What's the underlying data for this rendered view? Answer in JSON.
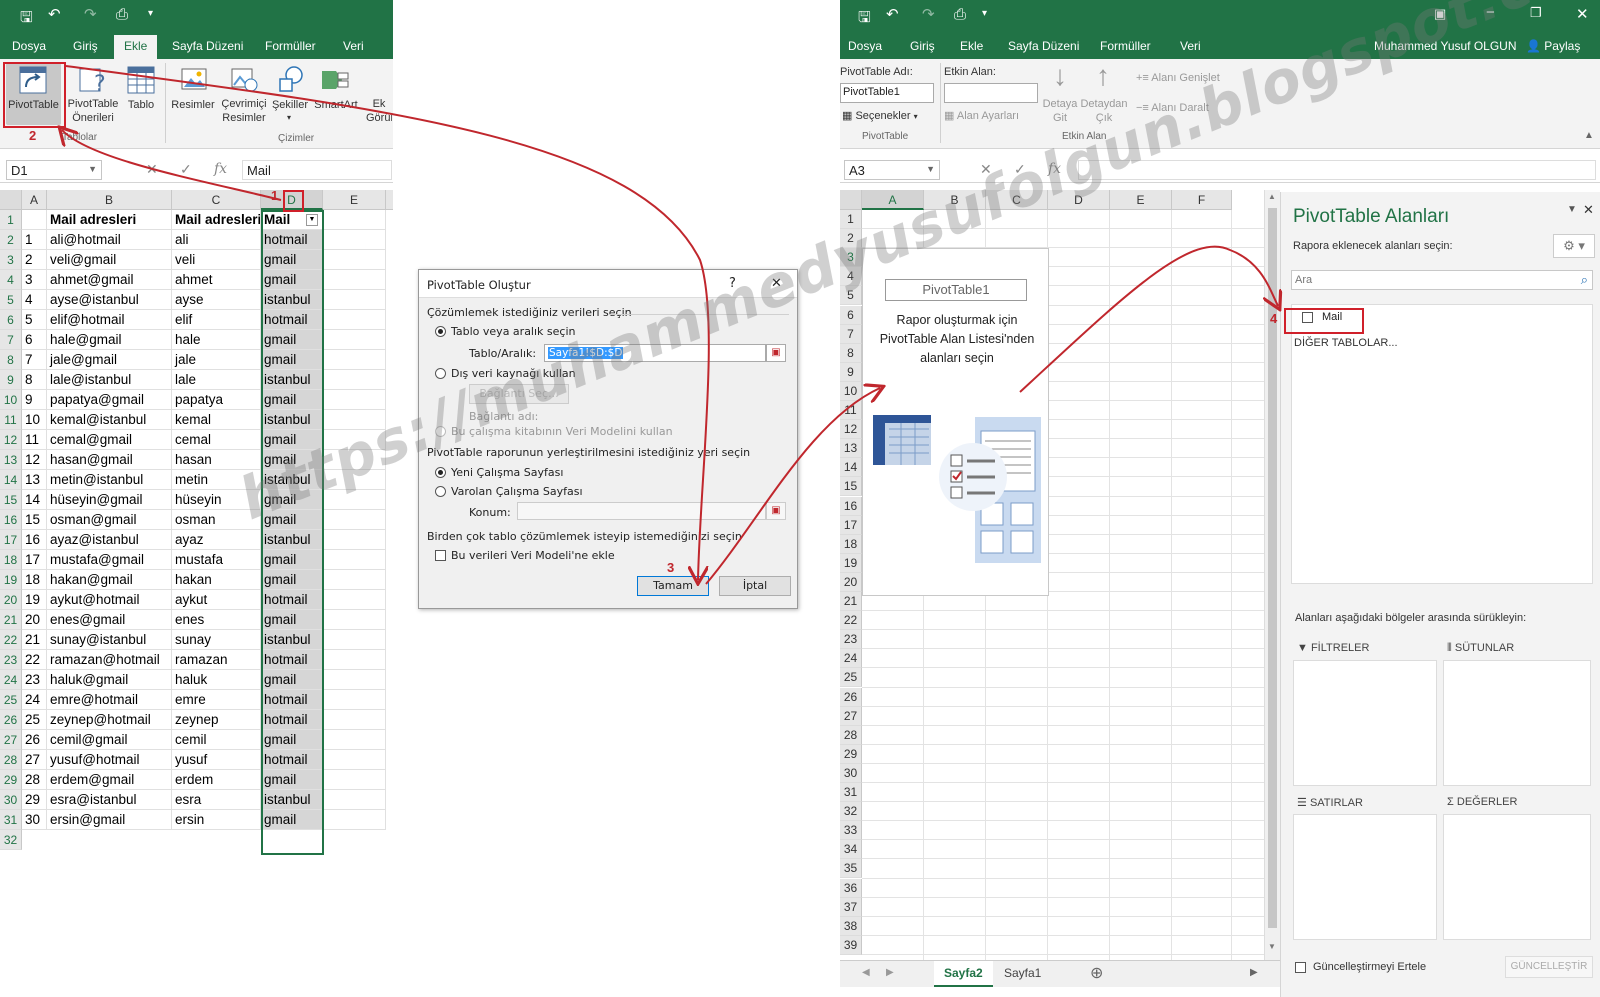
{
  "left": {
    "tabs": [
      "Dosya",
      "Giriş",
      "Ekle",
      "Sayfa Düzeni",
      "Formüller",
      "Veri"
    ],
    "active_tab": "Ekle",
    "ribbon": {
      "pivottable": "PivotTable",
      "pivot_onerileri": "PivotTable Önerileri",
      "tablo": "Tablo",
      "resimler": "Resimler",
      "cevrimici_resimler": "Çevrimiçi Resimler",
      "sekiller": "Şekiller",
      "smartart": "SmartArt",
      "ek_gorunum": "Ek Görün",
      "group_tablolar": "Tablolar",
      "group_cizimler": "Çizimler"
    },
    "namebox": "D1",
    "formula": "Mail",
    "columns": [
      "A",
      "B",
      "C",
      "D",
      "E"
    ],
    "header_row": {
      "b": "Mail adresleri",
      "c": "Mail adresleri",
      "d": "Mail"
    },
    "rows": [
      {
        "a": "1",
        "b": "ali@hotmail",
        "c": "ali",
        "d": "hotmail"
      },
      {
        "a": "2",
        "b": "veli@gmail",
        "c": "veli",
        "d": "gmail"
      },
      {
        "a": "3",
        "b": "ahmet@gmail",
        "c": "ahmet",
        "d": "gmail"
      },
      {
        "a": "4",
        "b": "ayse@istanbul",
        "c": "ayse",
        "d": "istanbul"
      },
      {
        "a": "5",
        "b": "elif@hotmail",
        "c": "elif",
        "d": "hotmail"
      },
      {
        "a": "6",
        "b": "hale@gmail",
        "c": "hale",
        "d": "gmail"
      },
      {
        "a": "7",
        "b": "jale@gmail",
        "c": "jale",
        "d": "gmail"
      },
      {
        "a": "8",
        "b": "lale@istanbul",
        "c": "lale",
        "d": "istanbul"
      },
      {
        "a": "9",
        "b": "papatya@gmail",
        "c": "papatya",
        "d": "gmail"
      },
      {
        "a": "10",
        "b": "kemal@istanbul",
        "c": "kemal",
        "d": "istanbul"
      },
      {
        "a": "11",
        "b": "cemal@gmail",
        "c": "cemal",
        "d": "gmail"
      },
      {
        "a": "12",
        "b": "hasan@gmail",
        "c": "hasan",
        "d": "gmail"
      },
      {
        "a": "13",
        "b": "metin@istanbul",
        "c": "metin",
        "d": "istanbul"
      },
      {
        "a": "14",
        "b": "hüseyin@gmail",
        "c": "hüseyin",
        "d": "gmail"
      },
      {
        "a": "15",
        "b": "osman@gmail",
        "c": "osman",
        "d": "gmail"
      },
      {
        "a": "16",
        "b": "ayaz@istanbul",
        "c": "ayaz",
        "d": "istanbul"
      },
      {
        "a": "17",
        "b": "mustafa@gmail",
        "c": "mustafa",
        "d": "gmail"
      },
      {
        "a": "18",
        "b": "hakan@gmail",
        "c": "hakan",
        "d": "gmail"
      },
      {
        "a": "19",
        "b": "aykut@hotmail",
        "c": "aykut",
        "d": "hotmail"
      },
      {
        "a": "20",
        "b": "enes@gmail",
        "c": "enes",
        "d": "gmail"
      },
      {
        "a": "21",
        "b": "sunay@istanbul",
        "c": "sunay",
        "d": "istanbul"
      },
      {
        "a": "22",
        "b": "ramazan@hotmail",
        "c": "ramazan",
        "d": "hotmail"
      },
      {
        "a": "23",
        "b": "haluk@gmail",
        "c": "haluk",
        "d": "gmail"
      },
      {
        "a": "24",
        "b": "emre@hotmail",
        "c": "emre",
        "d": "hotmail"
      },
      {
        "a": "25",
        "b": "zeynep@hotmail",
        "c": "zeynep",
        "d": "hotmail"
      },
      {
        "a": "26",
        "b": "cemil@gmail",
        "c": "cemil",
        "d": "gmail"
      },
      {
        "a": "27",
        "b": "yusuf@hotmail",
        "c": "yusuf",
        "d": "hotmail"
      },
      {
        "a": "28",
        "b": "erdem@gmail",
        "c": "erdem",
        "d": "gmail"
      },
      {
        "a": "29",
        "b": "esra@istanbul",
        "c": "esra",
        "d": "istanbul"
      },
      {
        "a": "30",
        "b": "ersin@gmail",
        "c": "ersin",
        "d": "gmail"
      }
    ],
    "last_row_number": "32"
  },
  "dialog": {
    "title": "PivotTable Oluştur",
    "help": "?",
    "close": "✕",
    "section1": "Çözümlemek istediğiniz verileri seçin",
    "opt_table": "Tablo veya aralık seçin",
    "range_label": "Tablo/Aralık:",
    "range_value": "Sayfa1!$D:$D",
    "opt_external": "Dış veri kaynağı kullan",
    "btn_connection": "Bağlantı Seç...",
    "connection_name": "Bağlantı adı:",
    "opt_datamodel": "Bu çalışma kitabının Veri Modelini kullan",
    "section2": "PivotTable raporunun yerleştirilmesini istediğiniz yeri seçin",
    "opt_new_sheet": "Yeni Çalışma Sayfası",
    "opt_existing_sheet": "Varolan Çalışma Sayfası",
    "location_label": "Konum:",
    "section3": "Birden çok tablo çözümlemek isteyip istemediğinizi seçin",
    "chk_datamodel": "Bu verileri Veri Modeli'ne ekle",
    "btn_ok": "Tamam",
    "btn_cancel": "İptal"
  },
  "right": {
    "tabs": [
      "Dosya",
      "Giriş",
      "Ekle",
      "Sayfa Düzeni",
      "Formüller",
      "Veri"
    ],
    "user": "Muhammed Yusuf OLGUN",
    "share": "Paylaş",
    "ribbon": {
      "pivot_name_label": "PivotTable Adı:",
      "pivot_name_value": "PivotTable1",
      "options": "Seçenekler",
      "group_pivottable": "PivotTable",
      "active_field_label": "Etkin Alan:",
      "field_settings": "Alan Ayarları",
      "drill_down": "Detaya Git",
      "drill_up": "Detaydan Çık",
      "expand_field": "Alanı Genişlet",
      "collapse_field": "Alanı Daralt",
      "group_active_field": "Etkin Alan"
    },
    "namebox": "A3",
    "columns": [
      "A",
      "B",
      "C",
      "D",
      "E",
      "F"
    ],
    "row_count": 39,
    "placeholder_title": "PivotTable1",
    "placeholder_text": "Rapor oluşturmak için PivotTable Alan Listesi'nden alanları seçin",
    "sheet_tabs": [
      "Sayfa2",
      "Sayfa1"
    ],
    "active_sheet": "Sayfa2"
  },
  "field_list": {
    "title": "PivotTable Alanları",
    "choose_label": "Rapora eklenecek alanları seçin:",
    "search_placeholder": "Ara",
    "fields": [
      "Mail"
    ],
    "other_tables": "DİĞER TABLOLAR...",
    "drag_label": "Alanları aşağıdaki bölgeler arasında sürükleyin:",
    "areas": {
      "filters": "FİLTRELER",
      "columns": "SÜTUNLAR",
      "rows": "SATIRLAR",
      "values": "DEĞERLER"
    },
    "defer_label": "Güncelleştirmeyi Ertele",
    "update_button": "GÜNCELLEŞTİR"
  },
  "annotations": [
    "1",
    "2",
    "3",
    "4"
  ],
  "watermark": "https://muhammedyusufolgun.blogspot.com",
  "colors": {
    "excel_green": "#217346",
    "annotation_red": "#c0272d"
  }
}
